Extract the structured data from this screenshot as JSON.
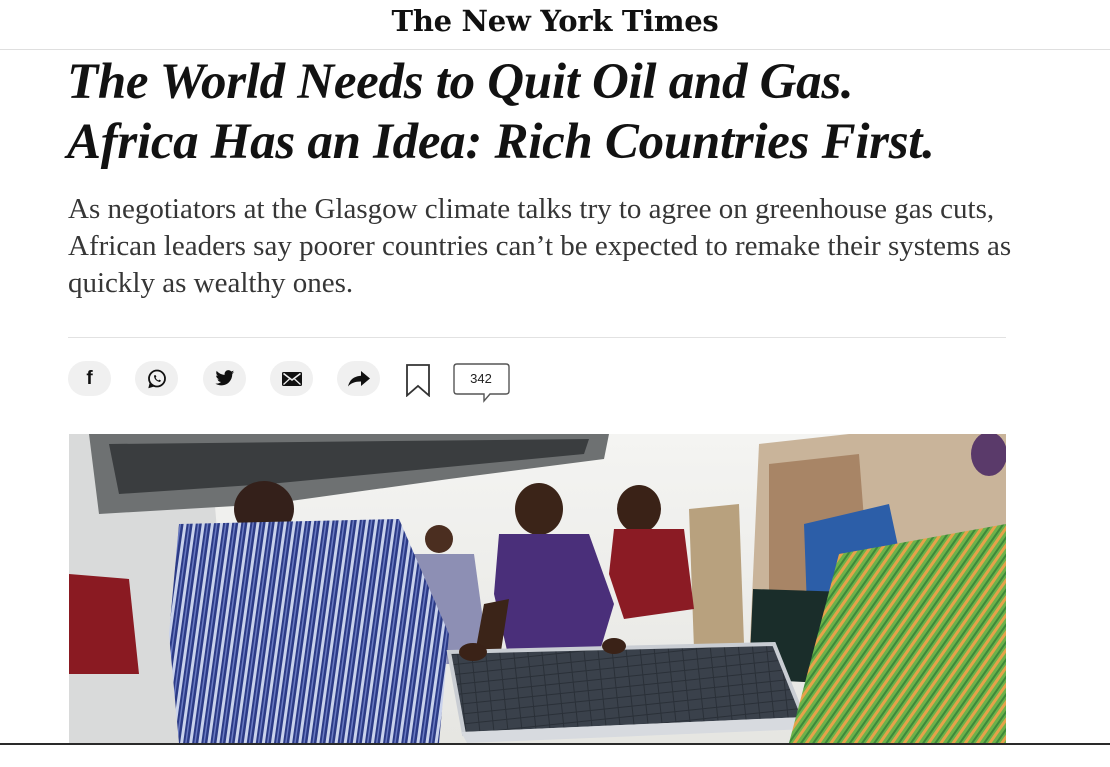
{
  "masthead": {
    "logo_text": "The New York Times"
  },
  "article": {
    "headline_line1": "The World Needs to Quit Oil and Gas.",
    "headline_line2": "Africa Has an Idea: Rich Countries First.",
    "summary": "As negotiators at the Glasgow climate talks try to agree on greenhouse gas cuts, African leaders say poorer countries can’t be expected to remake their systems as quickly as wealthy ones."
  },
  "share_tools": {
    "facebook_glyph": "f",
    "comment_count": "342",
    "icons": [
      "facebook-icon",
      "whatsapp-icon",
      "twitter-icon",
      "email-icon",
      "share-icon",
      "bookmark-icon",
      "comment-icon"
    ]
  },
  "colors": {
    "headline": "#121212",
    "summary": "#363636",
    "button_bg": "#f0f0f0",
    "divider": "#e2e2e2"
  }
}
